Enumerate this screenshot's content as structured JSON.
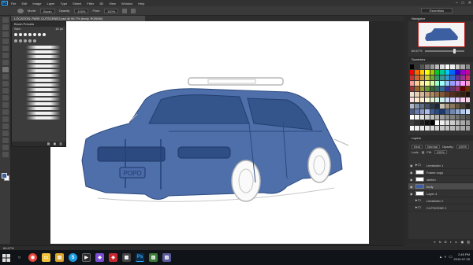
{
  "app": {
    "logo": "Ps",
    "menu": [
      "File",
      "Edit",
      "Image",
      "Layer",
      "Type",
      "Select",
      "Filter",
      "3D",
      "View",
      "Window",
      "Help"
    ],
    "window_controls": [
      "–",
      "□",
      "✕"
    ],
    "workspace": "Essentials"
  },
  "options_bar": {
    "mode_label": "Mode:",
    "mode_value": "Brush",
    "opacity_label": "Opacity:",
    "opacity_value": "100%",
    "flow_label": "Flow:",
    "flow_value": "100%"
  },
  "document": {
    "tab_title": "LOCATION: PARK CUTSCENE2.psd @ 66.7% (body, RGB/8#)",
    "zoom_status": "66.67%"
  },
  "brush_presets": {
    "title": "Brush Presets",
    "size_label": "Size:",
    "size_value": "18 px"
  },
  "navigator": {
    "title": "Navigator",
    "zoom": "66.67%"
  },
  "swatches": {
    "title": "Swatches",
    "colors": [
      "#000000",
      "#333333",
      "#555555",
      "#777777",
      "#999999",
      "#bbbbbb",
      "#dddddd",
      "#ffffff",
      "#eeeeee",
      "#cccccc",
      "#aaaaaa",
      "#888888",
      "#ff0000",
      "#ff6600",
      "#ffcc00",
      "#ffff00",
      "#99cc00",
      "#00cc33",
      "#00cc99",
      "#00ccff",
      "#0066ff",
      "#3300cc",
      "#9900cc",
      "#cc0099",
      "#cc3333",
      "#cc6633",
      "#cc9933",
      "#cccc33",
      "#66aa33",
      "#339966",
      "#339999",
      "#3399cc",
      "#3366cc",
      "#663399",
      "#993399",
      "#cc3366",
      "#ff9999",
      "#ffcc99",
      "#ffee99",
      "#ffff99",
      "#ccff99",
      "#99ffcc",
      "#99ffff",
      "#99ccff",
      "#9999ff",
      "#cc99ff",
      "#ff99ff",
      "#ff99cc",
      "#993333",
      "#996633",
      "#999933",
      "#669933",
      "#336633",
      "#336666",
      "#336699",
      "#333399",
      "#663366",
      "#993366",
      "#660000",
      "#663300",
      "#f0e0d0",
      "#e8d0b8",
      "#d8b898",
      "#c8a078",
      "#b08860",
      "#987048",
      "#805838",
      "#684028",
      "#503020",
      "#402818",
      "#302010",
      "#201008",
      "#ffe0e0",
      "#ffe8d0",
      "#fff0d0",
      "#f8f8d0",
      "#e0f0d0",
      "#d0f0e0",
      "#d0f0f0",
      "#d0e0f8",
      "#d8d0f8",
      "#e8d0f8",
      "#f8d0f0",
      "#f8d0e0",
      "#b0b8c8",
      "#8090a8",
      "#607088",
      "#405068",
      "#283848",
      "#1c2838",
      "#c8c0b0",
      "#a89880",
      "#887860",
      "#685840",
      "#484030",
      "#282018",
      "#4a5a8a",
      "#6a7aaa",
      "#8a9aca",
      "#aabaea",
      "#3b5fa0",
      "#2a4a80",
      "#1a3a70",
      "#506890",
      "#7088b0",
      "#90a8d0",
      "#b0c8f0",
      "#d0e0ff",
      "#ffffff",
      "#f0f0f0",
      "#e0e0e0",
      "#d0d0d0",
      "#c0c0c0",
      "#b0b0b0",
      "#a0a0a0",
      "#909090",
      "#808080",
      "#707070",
      "#606060",
      "#505050",
      "#404040",
      "#303030",
      "#202020",
      "#101010",
      "#000000",
      "#ffffff",
      "#eeeeee",
      "#dddddd",
      "#cccccc",
      "#bbbbbb",
      "#aaaaaa",
      "#999999",
      "#f8f8f8",
      "#f0f0f0",
      "#e8e8e8",
      "#e0e0e0",
      "#d8d8d8",
      "#d0d0d0",
      "#c8c8c8",
      "#c0c0c0",
      "#b8b8b8",
      "#b0b0b0",
      "#a8a8a8",
      "#a0a0a0"
    ]
  },
  "layers": {
    "title": "Layers",
    "kind_label": "Kind",
    "mode": "Normal",
    "opacity_label": "Opacity:",
    "opacity_value": "100%",
    "lock_label": "Lock:",
    "fill_label": "Fill:",
    "fill_value": "100%",
    "items": [
      {
        "name": "Limsticker 1",
        "type": "folder",
        "visible": true,
        "active": false
      },
      {
        "name": "Frame copy",
        "type": "layer",
        "visible": true,
        "active": false
      },
      {
        "name": "sketch",
        "type": "layer",
        "visible": true,
        "active": false
      },
      {
        "name": "body",
        "type": "layer",
        "visible": true,
        "active": true
      },
      {
        "name": "Layer 4",
        "type": "layer",
        "visible": true,
        "active": false
      },
      {
        "name": "Limsticker 2",
        "type": "folder",
        "visible": false,
        "active": false
      },
      {
        "name": "CUTSCENE 2",
        "type": "folder",
        "visible": false,
        "active": false
      }
    ]
  },
  "statusbar": {
    "zoom": "66.67%"
  },
  "taskbar": {
    "time": "2:45 PM",
    "date": "2019-07-25"
  },
  "canvas": {
    "license_plate": "POPO",
    "car_fill": "#3b5fa0"
  }
}
